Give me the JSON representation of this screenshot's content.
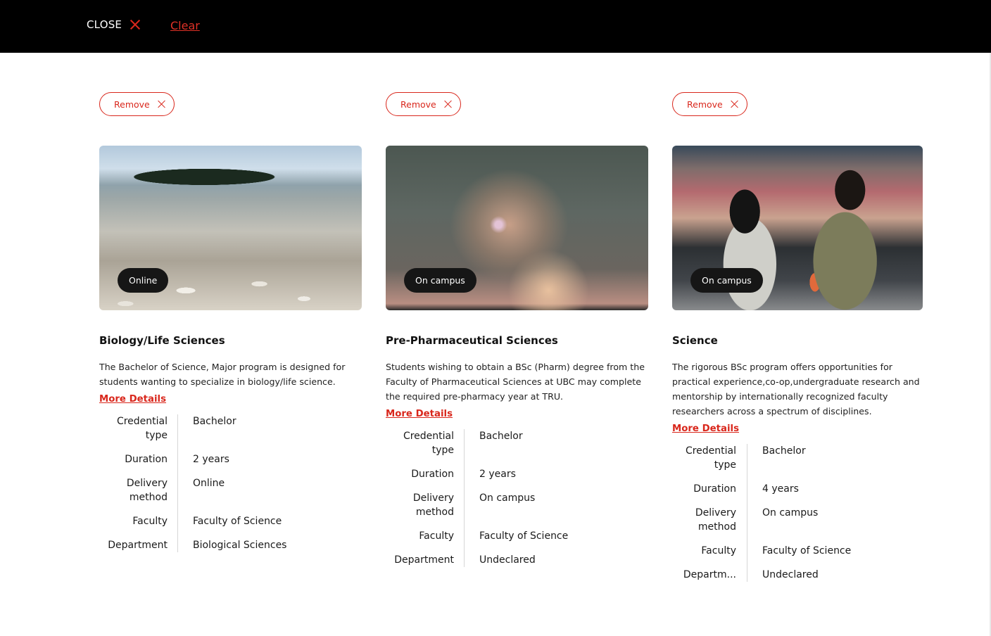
{
  "header": {
    "close_label": "CLOSE",
    "clear_label": "Clear"
  },
  "programs": [
    {
      "remove_label": "Remove",
      "badge": "Online",
      "title": "Biology/Life Sciences",
      "description": "The Bachelor of Science, Major program is designed for students wanting to specialize in biology/life science.",
      "more_label": "More Details",
      "specs": [
        {
          "label": "Credential type",
          "value": "Bachelor"
        },
        {
          "label": "Duration",
          "value": "2 years"
        },
        {
          "label": "Delivery method",
          "value": "Online"
        },
        {
          "label": "Faculty",
          "value": "Faculty of Science"
        },
        {
          "label": "Department",
          "value": "Biological Sciences"
        }
      ]
    },
    {
      "remove_label": "Remove",
      "badge": "On campus",
      "title": "Pre-Pharmaceutical Sciences",
      "description": "Students wishing to obtain a BSc (Pharm) degree from the Faculty of Pharmaceutical Sciences at UBC may complete the required pre-pharmacy year at TRU.",
      "more_label": "More Details",
      "specs": [
        {
          "label": "Credential type",
          "value": "Bachelor"
        },
        {
          "label": "Duration",
          "value": "2 years"
        },
        {
          "label": "Delivery method",
          "value": "On campus"
        },
        {
          "label": "Faculty",
          "value": "Faculty of Science"
        },
        {
          "label": "Department",
          "value": "Undeclared"
        }
      ]
    },
    {
      "remove_label": "Remove",
      "badge": "On campus",
      "title": "Science",
      "description": "The rigorous BSc program offers opportunities for practical experience,co-op,undergraduate research and mentorship by internationally recognized faculty researchers across a spectrum of disciplines.",
      "more_label": "More Details",
      "specs": [
        {
          "label": "Credential type",
          "value": "Bachelor"
        },
        {
          "label": "Duration",
          "value": "4 years"
        },
        {
          "label": "Delivery method",
          "value": "On campus"
        },
        {
          "label": "Faculty",
          "value": "Faculty of Science"
        },
        {
          "label": "Departm...",
          "value": "Undeclared"
        }
      ]
    }
  ],
  "colors": {
    "accent": "#d9271c",
    "header_bg": "#000000",
    "badge_bg": "#161616"
  }
}
